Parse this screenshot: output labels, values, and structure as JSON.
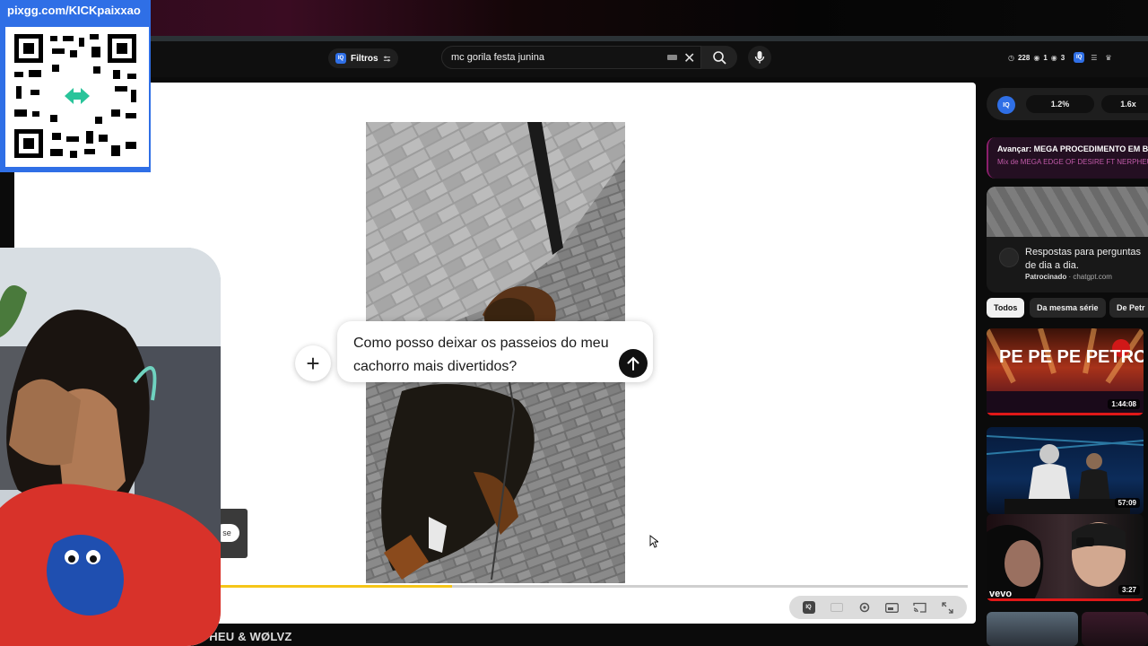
{
  "stream": {
    "qr_url": "pixgg.com/KICKpaixxao",
    "bottom_title": "MEGA EDGE OF DESIRE FT NERPHEU & WØLVZ"
  },
  "topbar": {
    "filters_label": "Filtros",
    "search_value": "mc gorila festa junina",
    "stats": {
      "time": "228",
      "eye": "1",
      "views": "3"
    }
  },
  "player": {
    "chat_prompt": "Como posso deixar os passeios do meu cachorro mais divertidos?",
    "skip_label": "se",
    "progress": 0.31,
    "accent": "#f5c518"
  },
  "sidebar": {
    "ext_values": [
      "1.2%",
      "1.6x"
    ],
    "next_up": {
      "title": "Avançar: MEGA PROCEDIMENTO EM BA",
      "subtitle": "Mix de MEGA EDGE OF DESIRE FT NERPHEU &"
    },
    "ad": {
      "text": "Respostas para perguntas de dia a dia.",
      "sponsored": "Patrocinado",
      "domain": "chatgpt.com"
    },
    "chips": [
      "Todos",
      "Da mesma série",
      "De Petr"
    ],
    "videos": [
      {
        "duration": "1:44:08",
        "title_art": "PE PE PE PETROSKI",
        "watched": 1.0
      },
      {
        "duration": "57:09",
        "watched": 0.0
      },
      {
        "duration": "3:27",
        "brand": "vevo",
        "watched": 1.0
      }
    ]
  }
}
